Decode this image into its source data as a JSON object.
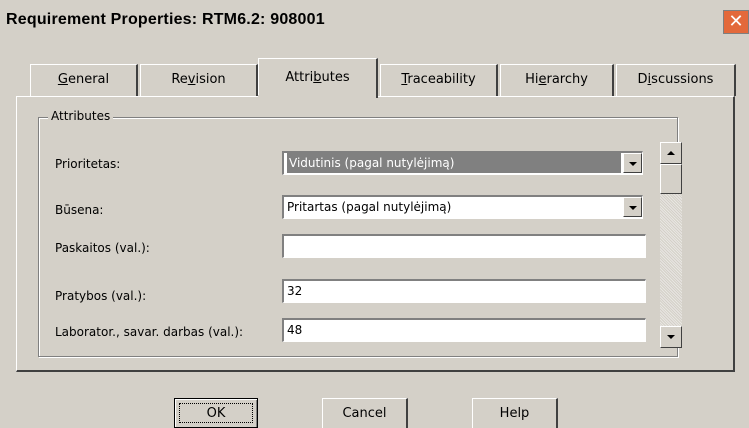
{
  "window": {
    "title": "Requirement Properties: RTM6.2: 908001",
    "close_glyph": "✕"
  },
  "tabs": [
    {
      "pre": "",
      "key": "G",
      "post": "eneral"
    },
    {
      "pre": "Re",
      "key": "v",
      "post": "ision"
    },
    {
      "pre": "Attri",
      "key": "b",
      "post": "utes"
    },
    {
      "pre": "",
      "key": "T",
      "post": "raceability"
    },
    {
      "pre": "Hi",
      "key": "e",
      "post": "rarchy"
    },
    {
      "pre": "D",
      "key": "i",
      "post": "scussions"
    }
  ],
  "active_tab": "Attributes",
  "group": {
    "label": "Attributes"
  },
  "fields": [
    {
      "label": "Prioritetas:",
      "value": "Vidutinis (pagal nutylėjimą)",
      "type": "dropdown",
      "selected": true
    },
    {
      "label": "Būsena:",
      "value": "Pritartas (pagal nutylėjimą)",
      "type": "dropdown",
      "selected": false
    },
    {
      "label": "Paskaitos (val.):",
      "value": "",
      "type": "text"
    },
    {
      "label": "Pratybos (val.):",
      "value": "32",
      "type": "text"
    },
    {
      "label": "Laborator., savar. darbas (val.):",
      "value": "48",
      "type": "text"
    }
  ],
  "buttons": {
    "ok": "OK",
    "cancel": "Cancel",
    "help": "Help"
  },
  "colors": {
    "selection": "#808080",
    "close_button": "#e3693b",
    "face": "#d4d0c8"
  }
}
